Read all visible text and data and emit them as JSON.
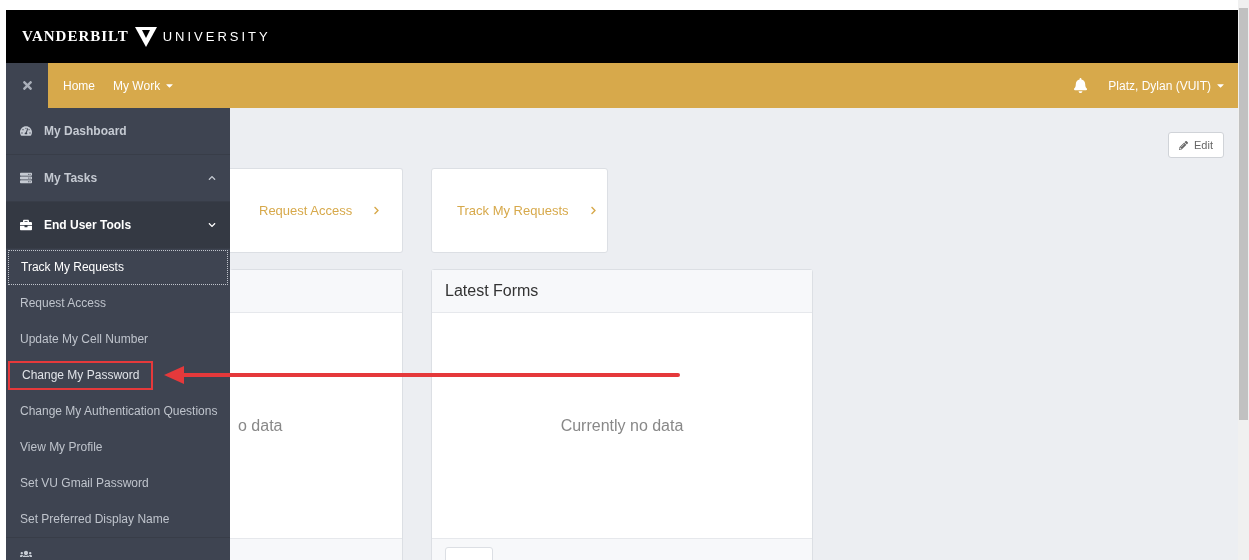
{
  "brand": {
    "left": "VANDERBILT",
    "right": "UNIVERSITY"
  },
  "nav": {
    "items": [
      {
        "label": "Home",
        "dropdown": false
      },
      {
        "label": "My Work",
        "dropdown": true
      }
    ],
    "user": "Platz, Dylan (VUIT)"
  },
  "sidebar": {
    "items": [
      {
        "label": "My Dashboard"
      },
      {
        "label": "My Tasks",
        "expanded": false
      },
      {
        "label": "End User Tools",
        "expanded": true,
        "children": [
          {
            "label": "Track My Requests",
            "selected": true,
            "callout": false
          },
          {
            "label": "Request Access",
            "selected": false,
            "callout": false
          },
          {
            "label": "Update My Cell Number",
            "selected": false,
            "callout": false
          },
          {
            "label": "Change My Password",
            "selected": false,
            "callout": true
          },
          {
            "label": "Change My Authentication Questions",
            "selected": false,
            "callout": false
          },
          {
            "label": "View My Profile",
            "selected": false,
            "callout": false
          },
          {
            "label": "Set VU Gmail Password",
            "selected": false,
            "callout": false
          },
          {
            "label": "Set Preferred Display Name",
            "selected": false,
            "callout": false
          }
        ]
      }
    ]
  },
  "page": {
    "edit_button": "Edit",
    "tiles": [
      "Request Access",
      "Track My Requests"
    ],
    "panels": [
      {
        "body": "o data"
      },
      {
        "title": "Latest Forms",
        "body": "Currently no data"
      }
    ]
  }
}
